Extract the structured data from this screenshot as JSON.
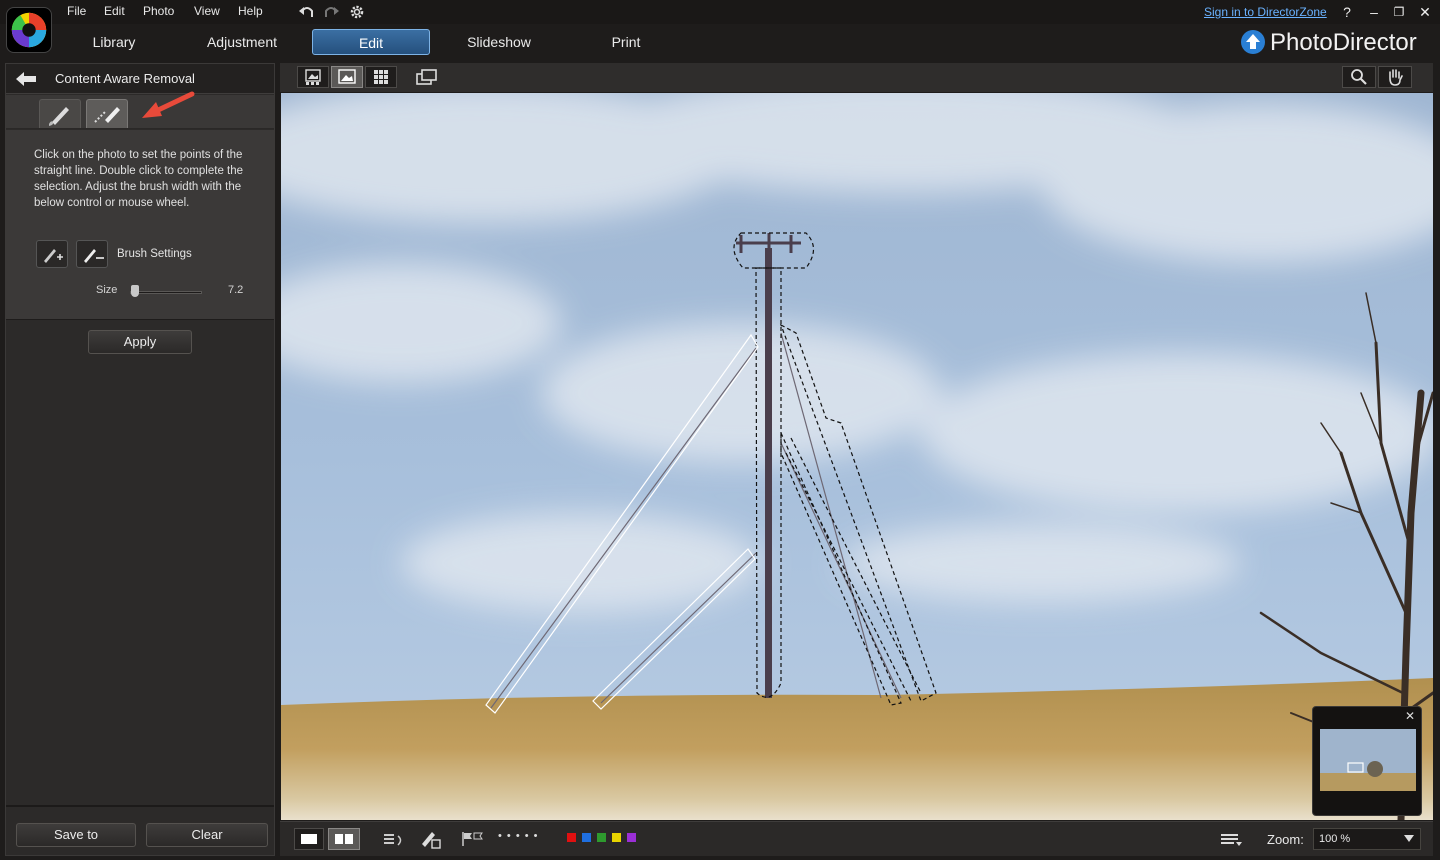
{
  "menu": {
    "items": [
      "File",
      "Edit",
      "Photo",
      "View",
      "Help"
    ],
    "signin": "Sign in to DirectorZone",
    "help_glyph": "?",
    "minimize_glyph": "–",
    "restore_glyph": "❐",
    "close_glyph": "✕"
  },
  "modules": {
    "tabs": [
      "Library",
      "Adjustment",
      "Edit",
      "Slideshow",
      "Print"
    ],
    "active": "Edit",
    "brand": "PhotoDirector"
  },
  "panel": {
    "title": "Content Aware Removal",
    "instructions": "Click on the photo to set the points of the straight line. Double click to complete the selection. Adjust the brush width with the below control or mouse wheel.",
    "brush_settings_label": "Brush Settings",
    "size_label": "Size",
    "size_value": "7.2",
    "size_fraction": 0.07,
    "apply_label": "Apply",
    "save_label": "Save to",
    "clear_label": "Clear"
  },
  "viewer": {
    "zoom_label": "Zoom:",
    "zoom_value": "100 %",
    "nav_close_glyph": "✕",
    "dots": "• • • • •",
    "label_colors": [
      "#e01010",
      "#1f6fe0",
      "#2e9a2e",
      "#e8d400",
      "#9b2fd6"
    ]
  },
  "icons": {
    "undo": "undo-icon",
    "redo": "redo-icon",
    "settings": "gear-icon",
    "back": "back-arrow-icon",
    "search": "magnifier-icon",
    "hand": "hand-icon",
    "upload": "upload-arrow-icon"
  }
}
